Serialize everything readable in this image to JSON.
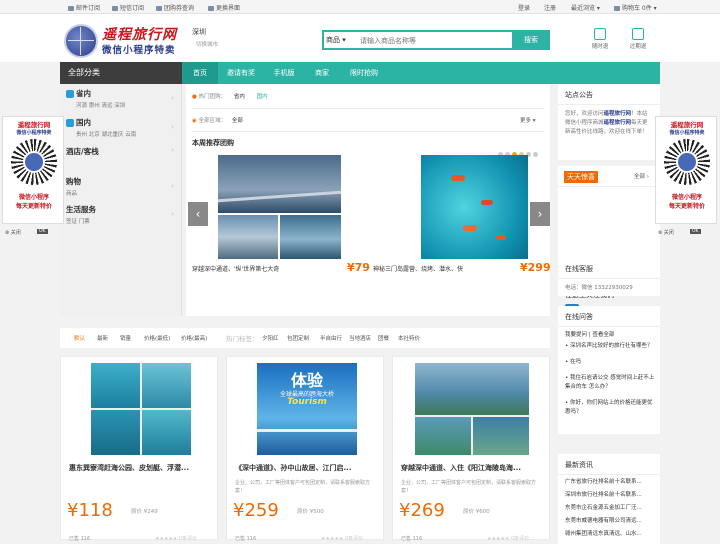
{
  "topbar": {
    "left": [
      "邮件订阅",
      "短信订阅",
      "团购券查询",
      "更换界面"
    ],
    "right": [
      "登录",
      "注册",
      "最近浏览",
      "购物车 0件"
    ]
  },
  "header": {
    "logo_title": "遥程旅行网",
    "logo_subtitle": "微信小程序特卖",
    "city": "深圳",
    "city_switch": "切换城市",
    "search_scope": "商品",
    "search_placeholder": "请输入商品名称等",
    "search_button": "搜索",
    "icon_refund": "随时退",
    "icon_expired": "过期退"
  },
  "nav": {
    "category": "全部分类",
    "items": [
      "首页",
      "邀请有奖",
      "手机版",
      "商家",
      "限时抢购"
    ]
  },
  "sidebar": [
    {
      "title": "省内",
      "sub": "河源  惠州  清远  深圳"
    },
    {
      "title": "国内",
      "sub": "贵州  北京  湖北重庆  云南"
    },
    {
      "title": "酒店/客栈",
      "sub": ""
    },
    {
      "title": "购物",
      "sub": "商品"
    },
    {
      "title": "生活服务",
      "sub": "签证  门票"
    }
  ],
  "main": {
    "hot_label": "热门团购：",
    "hot_items": [
      "省内",
      "国内"
    ],
    "area_label": "全部区域：",
    "area_value": "全部",
    "more": "更多",
    "rec_title": "本周推荐团购",
    "slides": [
      {
        "name": "穿越深中通道、'纵'世界第七大奇",
        "price": "¥79"
      },
      {
        "name": "神秘三门岛露营、烧烤、潜水、快",
        "price": "¥299"
      }
    ]
  },
  "right": {
    "notice_title": "站点公告",
    "notice_text_a": "您好，欢迎访问",
    "notice_link": "遥程旅行网",
    "notice_text_b": "！本站微信小程序商城",
    "notice_link2": "遥程旅行网",
    "notice_text_c": "每天更新高性价比线路，欢迎在线下单！",
    "daily_title": "天天惊喜",
    "daily_all": "全部",
    "follow_title": "在这里关注我们",
    "service_title": "在线客服",
    "service_text": "电话：微信 13322930029",
    "qa_title": "在线问答",
    "qa_links": "我要提问 | 查看全部",
    "qa_items": [
      "深圳名声比较好的旅行社有哪些？",
      "在吗",
      "我住石岩请公交 感觉时间上赶不上集合的车 怎么办？",
      "你好，你们网站上的价格还能更优惠吗？"
    ],
    "news_title": "最新资讯",
    "news_items": [
      "广东省旅行社排名前十名联系...",
      "深圳市旅行社排名前十名联系...",
      "东莞市企石金源五金加工厂汪...",
      "东莞市威德电器有限公司清远...",
      "赣州集团清远东真清远、山水..."
    ]
  },
  "filter": {
    "sorts": [
      "默认",
      "最新",
      "销量",
      "价格(最低)",
      "价格(最高)"
    ],
    "tag_label": "热门标签：",
    "tags": [
      "夕阳红",
      "包团定制",
      "半自由行",
      "当地酒店",
      "团餐",
      "本社特价"
    ]
  },
  "cards": [
    {
      "name": "惠东巽寮湾赶海公园、皮划艇、浮潜...",
      "desc": "",
      "price": "¥118",
      "old": "原价 ¥249",
      "sold": "已售 116",
      "stars": "★★★★★ 0条评价"
    },
    {
      "name": "《深中通道》、孙中山故居、江门启...",
      "desc": "企业，公司，工厂等团体客户可包团定制，请联系客服索取方案！",
      "price": "¥259",
      "old": "原价 ¥500",
      "sold": "已售 116",
      "stars": "★★★★★ 0条评价"
    },
    {
      "name": "穿越深中通道、入住《阳江海陵岛海...",
      "desc": "企业，公司，工厂等团体客户可包团定制，请联系客服索取方案！",
      "price": "¥269",
      "old": "原价 ¥600",
      "sold": "已售 116",
      "stars": "★★★★★ 0条评价"
    }
  ],
  "card2_banner": {
    "big": "体验",
    "line1": "全球最高的跨海大桥",
    "line2": "Tourism"
  },
  "qr": {
    "title": "遥程旅行网",
    "subtitle": "微信小程序特卖",
    "line1": "微信小程序",
    "line2": "每天更新特价",
    "close": "关闭",
    "ok": "OK"
  }
}
